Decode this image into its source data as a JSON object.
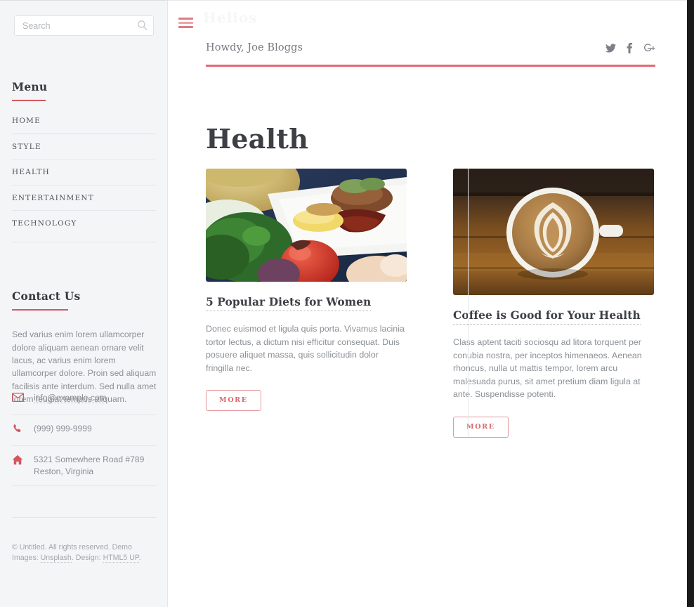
{
  "sidebar": {
    "search": {
      "placeholder": "Search",
      "value": "",
      "icon": "search-icon"
    },
    "menu_heading": "Menu",
    "menu_items": [
      {
        "label": "HOME"
      },
      {
        "label": "STYLE"
      },
      {
        "label": "HEALTH"
      },
      {
        "label": "ENTERTAINMENT"
      },
      {
        "label": "TECHNOLOGY"
      }
    ],
    "contact_heading": "Contact Us",
    "contact_copy": "Sed varius enim lorem ullamcorper dolore aliquam aenean ornare velit lacus, ac varius enim lorem ullamcorper dolore. Proin sed aliquam facilisis ante interdum. Sed nulla amet lorem feugiat tempus aliquam.",
    "contact_rows": [
      {
        "icon": "envelope-icon",
        "text": "info@example.com",
        "link": true
      },
      {
        "icon": "phone-icon",
        "text": "(999) 999-9999",
        "link": false
      },
      {
        "icon": "home-icon",
        "line1": "5321 Somewhere Road #789",
        "line2": "Reston, Virginia",
        "link": false
      }
    ],
    "colophon": {
      "part1": "© Untitled. All rights reserved. Demo Images: ",
      "link1": "Unsplash",
      "part2": ". Design: ",
      "link2": "HTML5 UP",
      "part3": "."
    }
  },
  "header": {
    "menu_toggle_icon": "hamburger-icon",
    "ghost_title": "Helios",
    "greeting": "Howdy, Joe Bloggs",
    "socials": [
      {
        "name": "twitter-icon",
        "label": "Twitter"
      },
      {
        "name": "facebook-icon",
        "label": "Facebook"
      },
      {
        "name": "google-plus-icon",
        "label": "Google+"
      }
    ]
  },
  "main": {
    "page_title": "Health",
    "posts": [
      {
        "image": "food-plate-photo",
        "title": "5 Popular Diets for Women",
        "body": "Donec euismod et ligula quis porta. Vivamus lacinia tortor lectus, a dictum nisi efficitur consequat. Duis posuere aliquet massa, quis sollicitudin dolor fringilla nec.",
        "more_label": "MORE"
      },
      {
        "image": "latte-coffee-photo",
        "title": "Coffee is Good for Your Health",
        "body": "Class aptent taciti sociosqu ad litora torquent per conubia nostra, per inceptos himenaeos. Aenean rhoncus, nulla ut mattis tempor, lorem arcu malesuada purus, sit amet pretium diam ligula at ante. Suspendisse potenti.",
        "more_label": "MORE"
      }
    ]
  },
  "colors": {
    "accent": "#e06a70",
    "accent_soft": "#d0595f",
    "sidebar_bg": "#f4f5f7",
    "text_dark": "#3c3f44",
    "text_muted": "#8b9096"
  }
}
